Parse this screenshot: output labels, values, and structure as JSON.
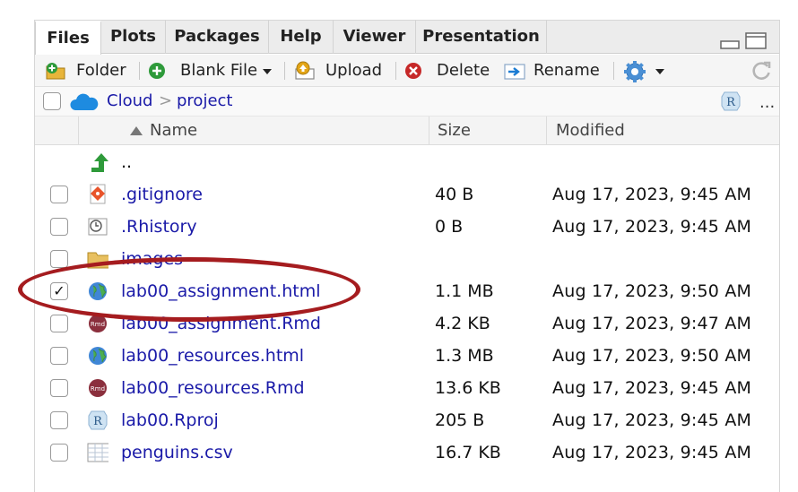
{
  "tabs": [
    {
      "label": "Files",
      "active": true
    },
    {
      "label": "Plots"
    },
    {
      "label": "Packages"
    },
    {
      "label": "Help"
    },
    {
      "label": "Viewer"
    },
    {
      "label": "Presentation"
    }
  ],
  "toolbar": {
    "folder_label": "Folder",
    "blank_file_label": "Blank File",
    "upload_label": "Upload",
    "delete_label": "Delete",
    "rename_label": "Rename"
  },
  "path": {
    "root": "Cloud",
    "separator": ">",
    "current": "project",
    "more": "..."
  },
  "columns": {
    "name": "Name",
    "size": "Size",
    "modified": "Modified"
  },
  "parent": {
    "label": ".."
  },
  "files": [
    {
      "name": ".gitignore",
      "size": "40 B",
      "modified": "Aug 17, 2023, 9:45 AM",
      "icon": "git-icon",
      "checked": false
    },
    {
      "name": ".Rhistory",
      "size": "0 B",
      "modified": "Aug 17, 2023, 9:45 AM",
      "icon": "history-icon",
      "checked": false
    },
    {
      "name": "images",
      "size": "",
      "modified": "",
      "icon": "folder-icon",
      "checked": false
    },
    {
      "name": "lab00_assignment.html",
      "size": "1.1 MB",
      "modified": "Aug 17, 2023, 9:50 AM",
      "icon": "globe-icon",
      "checked": true
    },
    {
      "name": "lab00_assignment.Rmd",
      "size": "4.2 KB",
      "modified": "Aug 17, 2023, 9:47 AM",
      "icon": "rmd-icon",
      "checked": false
    },
    {
      "name": "lab00_resources.html",
      "size": "1.3 MB",
      "modified": "Aug 17, 2023, 9:50 AM",
      "icon": "globe-icon",
      "checked": false
    },
    {
      "name": "lab00_resources.Rmd",
      "size": "13.6 KB",
      "modified": "Aug 17, 2023, 9:45 AM",
      "icon": "rmd-icon",
      "checked": false
    },
    {
      "name": "lab00.Rproj",
      "size": "205 B",
      "modified": "Aug 17, 2023, 9:45 AM",
      "icon": "rproj-icon",
      "checked": false
    },
    {
      "name": "penguins.csv",
      "size": "16.7 KB",
      "modified": "Aug 17, 2023, 9:45 AM",
      "icon": "spreadsheet-icon",
      "checked": false
    }
  ],
  "colors": {
    "link": "#1a1aa8",
    "highlight_ellipse": "#a51c1f"
  }
}
